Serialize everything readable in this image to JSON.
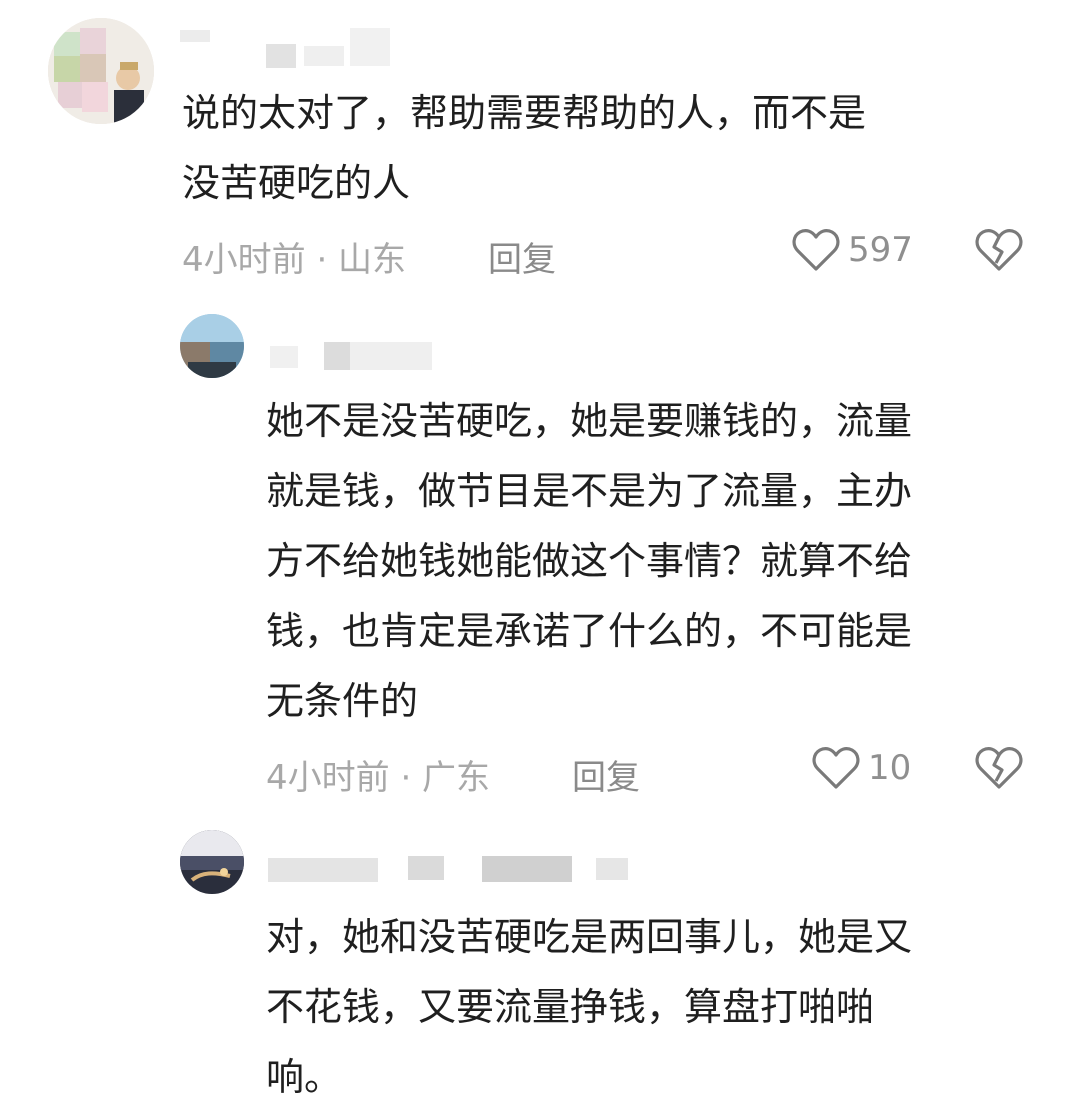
{
  "comments": [
    {
      "text_lines": [
        "说的太对了，帮助需要帮助的人，而不是",
        "没苦硬吃的人"
      ],
      "meta": "4小时前 · 山东",
      "reply_label": "回复",
      "like_count": "597"
    },
    {
      "text_lines": [
        "她不是没苦硬吃，她是要赚钱的，流量",
        "就是钱，做节目是不是为了流量，主办",
        "方不给她钱她能做这个事情？就算不给",
        "钱，也肯定是承诺了什么的，不可能是",
        "无条件的"
      ],
      "meta": "4小时前 · 广东",
      "reply_label": "回复",
      "like_count": "10"
    },
    {
      "text_lines": [
        "对，她和没苦硬吃是两回事儿，她是又",
        "不花钱，又要流量挣钱，算盘打啪啪",
        "响。"
      ]
    }
  ],
  "icons": {
    "like": "heart-outline-icon",
    "dislike": "broken-heart-icon"
  },
  "colors": {
    "text": "#1f1f1f",
    "meta": "#a8a8a8",
    "icon": "#7a7a7a"
  }
}
